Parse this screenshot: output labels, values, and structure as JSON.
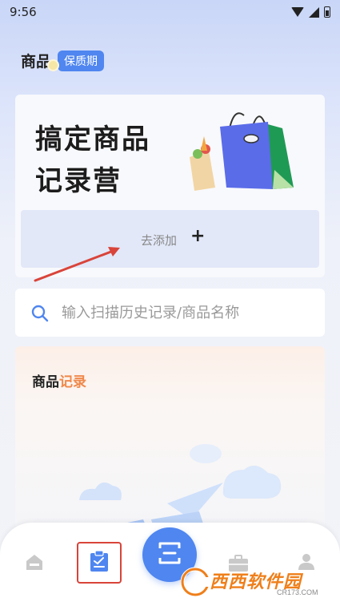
{
  "status_bar": {
    "time": "9:56"
  },
  "header": {
    "title": "商品",
    "tag": "保质期"
  },
  "hero": {
    "line1": "搞定商品",
    "line2": "记录营",
    "add_label": "去添加",
    "add_symbol": "+"
  },
  "search": {
    "placeholder": "输入扫描历史记录/商品名称",
    "icon": "search-icon"
  },
  "records": {
    "title_part1": "商品",
    "title_part2": "记录"
  },
  "nav": {
    "items": [
      "home-icon",
      "record-icon",
      "scan-icon",
      "briefcase-icon",
      "profile-icon"
    ]
  },
  "watermark": {
    "brand": "西西软件园",
    "site": "CR173.COM"
  },
  "colors": {
    "accent": "#4f86f0",
    "highlight": "#f0884a",
    "annotation": "#d9443a"
  }
}
